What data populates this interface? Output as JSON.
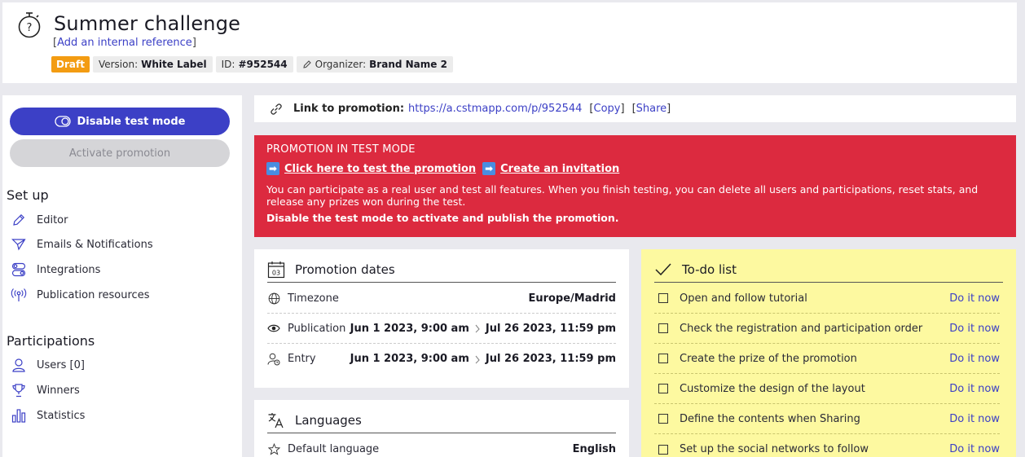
{
  "header": {
    "title": "Summer challenge",
    "ref_open": "[",
    "ref_link": "Add an internal reference",
    "ref_close": "]",
    "badges": {
      "status": "Draft",
      "version_label": "Version:",
      "version_value": "White Label",
      "id_label": "ID:",
      "id_value": "#952544",
      "organizer_label": "Organizer:",
      "organizer_value": "Brand Name 2"
    }
  },
  "sidebar": {
    "disable_test_mode": "Disable test mode",
    "activate_promotion": "Activate promotion",
    "setup_title": "Set up",
    "setup_items": [
      "Editor",
      "Emails & Notifications",
      "Integrations",
      "Publication resources"
    ],
    "participations_title": "Participations",
    "participation_items": [
      "Users [0]",
      "Winners",
      "Statistics"
    ]
  },
  "linkbar": {
    "label": "Link to promotion:",
    "url": "https://a.cstmapp.com/p/952544",
    "copy": "Copy",
    "share": "Share"
  },
  "alert": {
    "title": "PROMOTION IN TEST MODE",
    "test_link": "Click here to test the promotion",
    "invite_link": "Create an invitation",
    "description": "You can participate as a real user and test all features. When you finish testing, you can delete all users and participations, reset stats, and release any prizes won during the test.",
    "warning": "Disable the test mode to activate and publish the promotion."
  },
  "dates": {
    "title": "Promotion dates",
    "calendar_day": "03",
    "timezone_label": "Timezone",
    "timezone_value": "Europe/Madrid",
    "publication_label": "Publication",
    "publication_start": "Jun 1 2023, 9:00 am",
    "publication_end": "Jul 26 2023, 11:59 pm",
    "entry_label": "Entry",
    "entry_start": "Jun 1 2023, 9:00 am",
    "entry_end": "Jul 26 2023, 11:59 pm"
  },
  "languages": {
    "title": "Languages",
    "default_label": "Default language",
    "default_value": "English"
  },
  "todo": {
    "title": "To-do list",
    "action": "Do it now",
    "items": [
      "Open and follow tutorial",
      "Check the registration and participation order",
      "Create the prize of the promotion",
      "Customize the design of the layout",
      "Define the contents when Sharing",
      "Set up the social networks to follow"
    ]
  },
  "colors": {
    "accent": "#3c40c6",
    "alert": "#dc2a3f",
    "draft": "#f39c12",
    "todo_bg": "#fdf9a0"
  }
}
